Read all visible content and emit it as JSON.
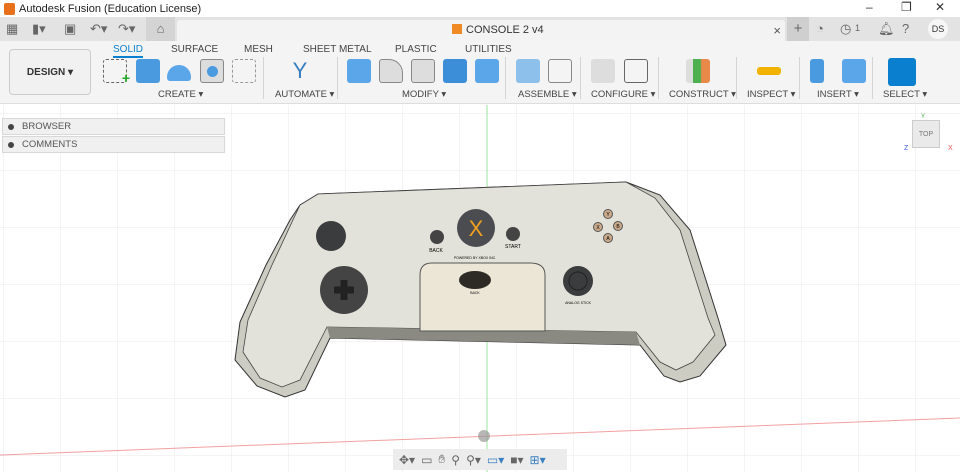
{
  "window": {
    "title": "Autodesk Fusion (Education License)",
    "minimize": "–",
    "restore": "❐",
    "close": "✕"
  },
  "quickbar": {
    "apps_icon": "grid-icon",
    "file_icon": "file-icon",
    "save_icon": "save-icon",
    "undo_icon": "undo-icon",
    "redo_icon": "redo-icon",
    "home_icon": "home-icon"
  },
  "document": {
    "name": "CONSOLE 2 v4",
    "close": "×"
  },
  "header_right": {
    "new_tab": "+",
    "jobs_count": "1",
    "user_initials": "DS"
  },
  "ribbon": {
    "workspace": "DESIGN ▾",
    "tabs": [
      "SOLID",
      "SURFACE",
      "MESH",
      "SHEET METAL",
      "PLASTIC",
      "UTILITIES"
    ],
    "active_tab": "SOLID",
    "groups": [
      "CREATE ▾",
      "AUTOMATE ▾",
      "MODIFY ▾",
      "ASSEMBLE ▾",
      "CONFIGURE ▾",
      "CONSTRUCT ▾",
      "INSPECT ▾",
      "INSERT ▾",
      "SELECT ▾"
    ]
  },
  "panels": {
    "browser": "BROWSER",
    "comments": "COMMENTS"
  },
  "viewcube": {
    "face": "TOP",
    "axes": [
      "Z",
      "X",
      "Y"
    ]
  },
  "model": {
    "labels": {
      "back": "BACK",
      "start": "START",
      "powered": "POWERED BY XBOX INC.",
      "back2": "BACK",
      "stick": "ANALOG STICK",
      "x": "X",
      "buttons": [
        "Y",
        "X",
        "B",
        "A"
      ]
    }
  },
  "colors": {
    "accent": "#0a80d0",
    "face": "#e2e2da",
    "panel": "#ece6d6"
  }
}
